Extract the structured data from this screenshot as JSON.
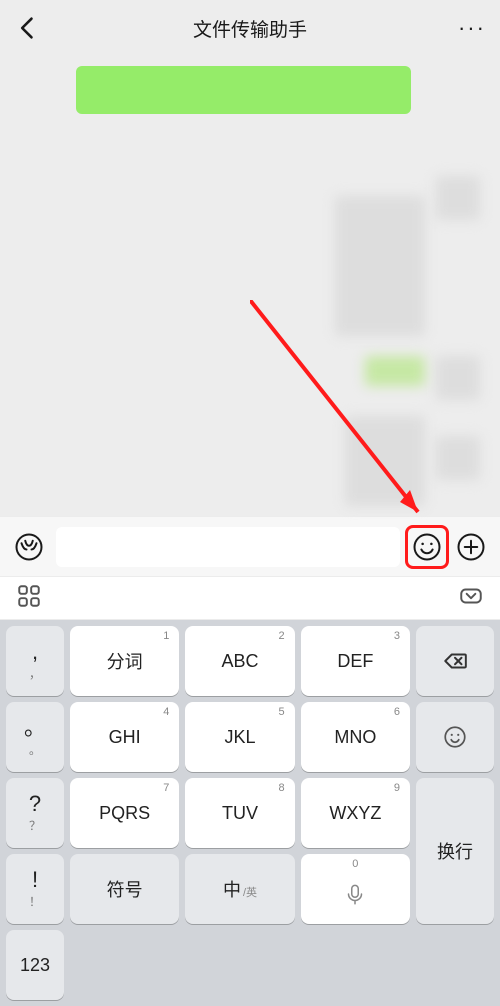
{
  "header": {
    "title": "文件传输助手"
  },
  "input": {
    "placeholder": ""
  },
  "keyboard": {
    "punct": [
      ",",
      "。",
      "?",
      "!"
    ],
    "punct_alt": [
      "，",
      "。",
      "？",
      "！"
    ],
    "keys": [
      {
        "sup": "1",
        "label": "分词"
      },
      {
        "sup": "2",
        "label": "ABC"
      },
      {
        "sup": "3",
        "label": "DEF"
      },
      {
        "sup": "4",
        "label": "GHI"
      },
      {
        "sup": "5",
        "label": "JKL"
      },
      {
        "sup": "6",
        "label": "MNO"
      },
      {
        "sup": "7",
        "label": "PQRS"
      },
      {
        "sup": "8",
        "label": "TUV"
      },
      {
        "sup": "9",
        "label": "WXYZ"
      }
    ],
    "symbol": "符号",
    "lang_main": "中",
    "lang_sub": "/英",
    "num": "123",
    "newline": "换行",
    "zero": "0"
  }
}
